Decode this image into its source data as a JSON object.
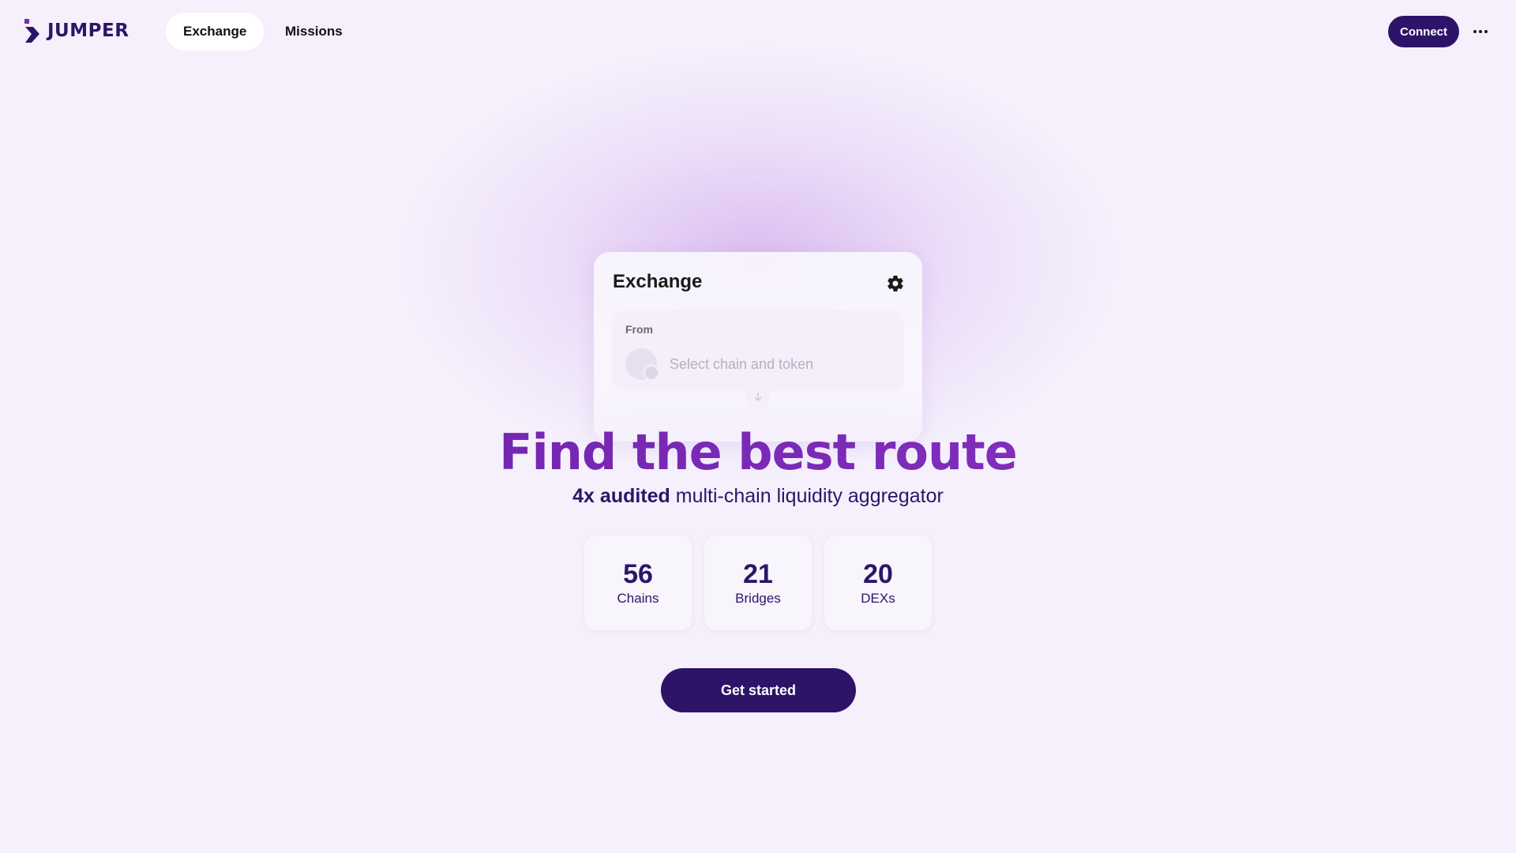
{
  "header": {
    "logo_text": "JUMPER",
    "tabs": [
      {
        "label": "Exchange",
        "active": true
      },
      {
        "label": "Missions",
        "active": false
      }
    ],
    "connect_label": "Connect",
    "more_icon": "more-horizontal-icon"
  },
  "widget": {
    "title": "Exchange",
    "settings_icon": "gear-icon",
    "from": {
      "label": "From",
      "placeholder": "Select chain and token"
    },
    "swap_icon": "arrow-down-icon"
  },
  "hero": {
    "title": "Find the best route",
    "subtitle_bold": "4x audited",
    "subtitle_rest": " multi-chain liquidity aggregator"
  },
  "stats": [
    {
      "value": "56",
      "label": "Chains"
    },
    {
      "value": "21",
      "label": "Bridges"
    },
    {
      "value": "20",
      "label": "DEXs"
    }
  ],
  "cta_label": "Get started",
  "colors": {
    "background": "#f5f0fc",
    "brand": "#2e1469",
    "accent": "#7a28b4"
  }
}
